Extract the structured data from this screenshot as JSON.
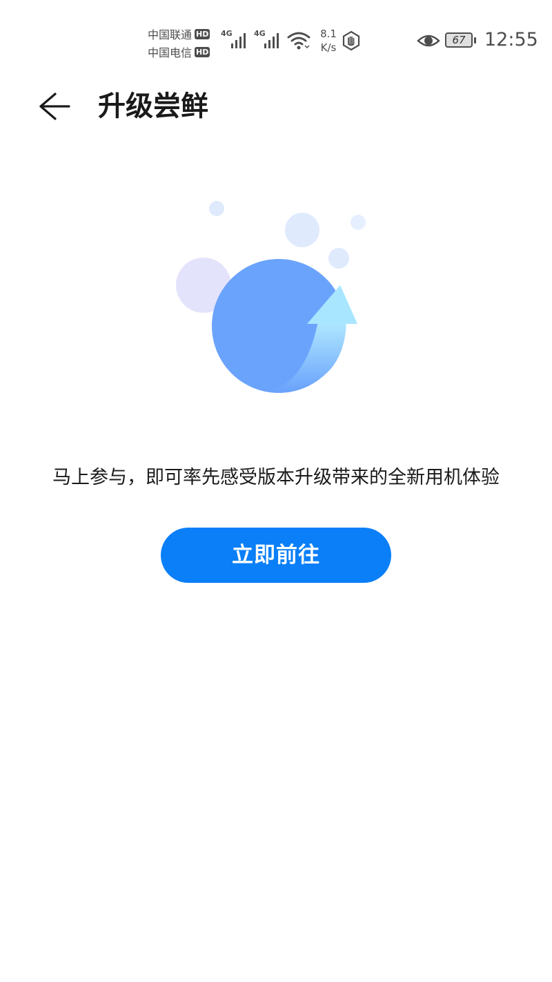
{
  "status_bar": {
    "carrier_1": "中国联通",
    "carrier_2": "中国电信",
    "hd_label": "HD",
    "network_type_1": "4G",
    "network_type_2": "4G",
    "net_speed_value": "8.1",
    "net_speed_unit": "K/s",
    "battery_level": "67",
    "time": "12:55",
    "icons": [
      "signal-icon",
      "wifi-icon",
      "hand-icon",
      "eye-icon",
      "battery-icon"
    ]
  },
  "header": {
    "back_icon": "back-arrow-icon",
    "title": "升级尝鲜"
  },
  "illustration": {
    "name": "upgrade-illustration",
    "colors": {
      "main_circle": "#6aa3fb",
      "arrow_light": "#a8e6ff",
      "arrow_dark": "#6aa3fb",
      "lavender_bubble": "#e4e3fc",
      "light_bubble": "#dfeafd"
    }
  },
  "main": {
    "description": "马上参与，即可率先感受版本升级带来的全新用机体验",
    "cta_label": "立即前往"
  },
  "colors": {
    "accent": "#0a7ff8",
    "text_primary": "#1a1a1a",
    "status_text": "#4d4d4d",
    "background": "#ffffff"
  }
}
